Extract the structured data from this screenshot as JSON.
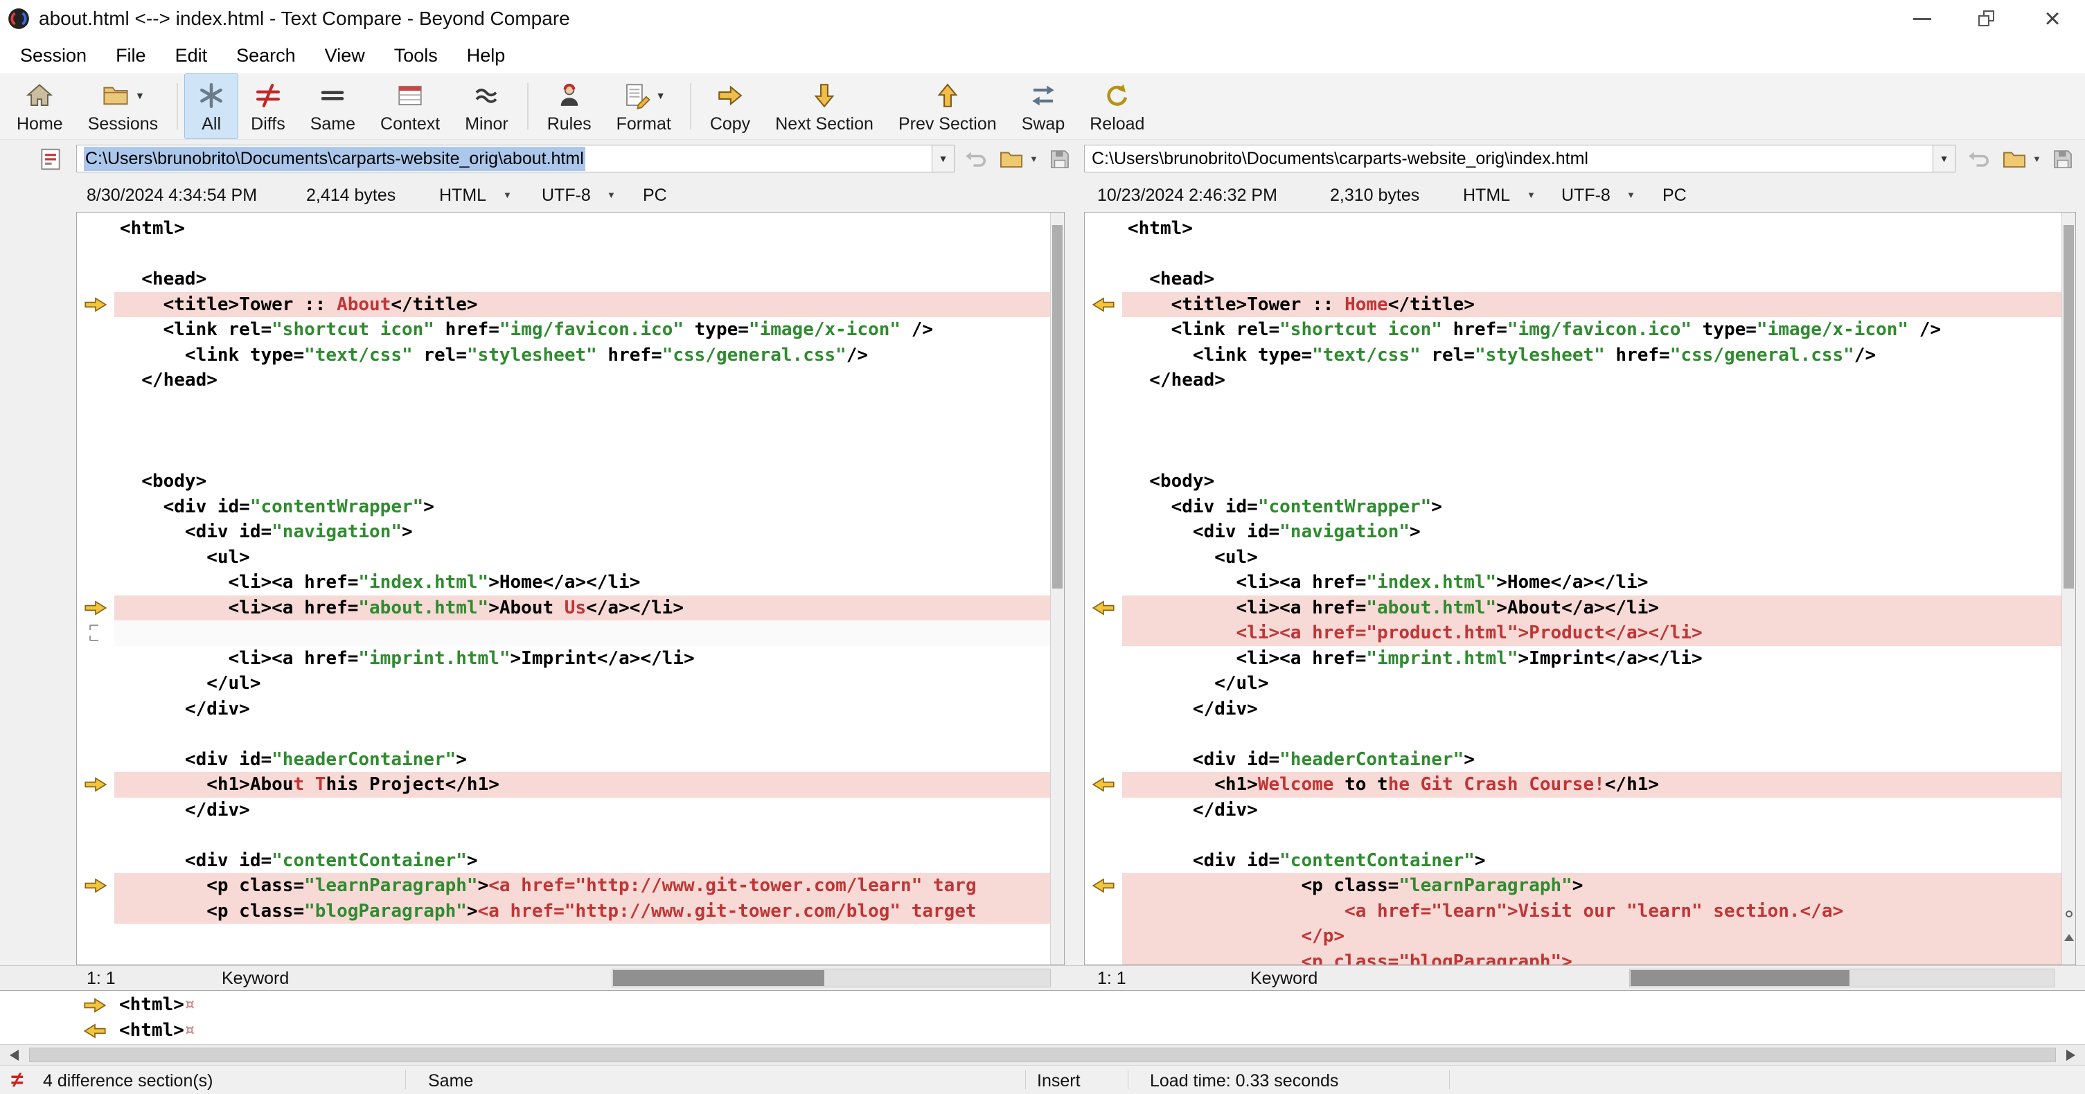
{
  "window": {
    "title": "about.html <--> index.html - Text Compare - Beyond Compare"
  },
  "menu": {
    "items": [
      "Session",
      "File",
      "Edit",
      "Search",
      "View",
      "Tools",
      "Help"
    ]
  },
  "toolbar": {
    "items": [
      {
        "label": "Home",
        "icon": "home-icon"
      },
      {
        "label": "Sessions",
        "icon": "sessions-icon",
        "has_dropdown": true
      },
      {
        "label": "All",
        "icon": "asterisk-icon",
        "active": true
      },
      {
        "label": "Diffs",
        "icon": "not-equal-icon"
      },
      {
        "label": "Same",
        "icon": "equals-icon"
      },
      {
        "label": "Context",
        "icon": "context-icon"
      },
      {
        "label": "Minor",
        "icon": "tilde-icon"
      },
      {
        "label": "Rules",
        "icon": "rules-icon"
      },
      {
        "label": "Format",
        "icon": "format-icon",
        "has_dropdown": true
      },
      {
        "label": "Copy",
        "icon": "copy-arrow-icon"
      },
      {
        "label": "Next Section",
        "icon": "arrow-down-icon"
      },
      {
        "label": "Prev Section",
        "icon": "arrow-up-icon"
      },
      {
        "label": "Swap",
        "icon": "swap-icon"
      },
      {
        "label": "Reload",
        "icon": "reload-icon"
      }
    ]
  },
  "left_file": {
    "path": "C:\\Users\\brunobrito\\Documents\\carparts-website_orig\\about.html",
    "modified": "8/30/2024 4:34:54 PM",
    "size": "2,414 bytes",
    "format": "HTML",
    "encoding": "UTF-8",
    "line_ending": "PC",
    "cursor": "1: 1",
    "grammar": "Keyword"
  },
  "right_file": {
    "path": "C:\\Users\\brunobrito\\Documents\\carparts-website_orig\\index.html",
    "modified": "10/23/2024 2:46:32 PM",
    "size": "2,310 bytes",
    "format": "HTML",
    "encoding": "UTF-8",
    "line_ending": "PC",
    "cursor": "1: 1",
    "grammar": "Keyword"
  },
  "left_lines": [
    {
      "spans": [
        [
          "t",
          "<html>"
        ]
      ]
    },
    {
      "spans": []
    },
    {
      "spans": [
        [
          "t",
          "  <head>"
        ]
      ]
    },
    {
      "bg": "d",
      "mk": "a",
      "spans": [
        [
          "t",
          "    <title>"
        ],
        [
          "n",
          "Tower :: "
        ],
        [
          "d",
          "About"
        ],
        [
          "t",
          "</title>"
        ]
      ]
    },
    {
      "spans": [
        [
          "t",
          "    <link rel="
        ],
        [
          "s",
          "\"shortcut icon\""
        ],
        [
          "t",
          " href="
        ],
        [
          "s",
          "\"img/favicon.ico\""
        ],
        [
          "t",
          " type="
        ],
        [
          "s",
          "\"image/x-icon\""
        ],
        [
          "t",
          " />"
        ]
      ]
    },
    {
      "spans": [
        [
          "t",
          "      <link type="
        ],
        [
          "s",
          "\"text/css\""
        ],
        [
          "t",
          " rel="
        ],
        [
          "s",
          "\"stylesheet\""
        ],
        [
          "t",
          " href="
        ],
        [
          "s",
          "\"css/general.css\""
        ],
        [
          "t",
          "/>"
        ]
      ]
    },
    {
      "spans": [
        [
          "t",
          "  </head>"
        ]
      ]
    },
    {
      "spans": []
    },
    {
      "spans": []
    },
    {
      "spans": []
    },
    {
      "spans": [
        [
          "t",
          "  <body>"
        ]
      ]
    },
    {
      "spans": [
        [
          "t",
          "    <div id="
        ],
        [
          "s",
          "\"contentWrapper\""
        ],
        [
          "t",
          ">"
        ]
      ]
    },
    {
      "spans": [
        [
          "t",
          "      <div id="
        ],
        [
          "s",
          "\"navigation\""
        ],
        [
          "t",
          ">"
        ]
      ]
    },
    {
      "spans": [
        [
          "t",
          "        <ul>"
        ]
      ]
    },
    {
      "spans": [
        [
          "t",
          "          <li><a href="
        ],
        [
          "s",
          "\"index.html\""
        ],
        [
          "t",
          ">Home</a></li>"
        ]
      ]
    },
    {
      "bg": "d",
      "mk": "a",
      "spans": [
        [
          "t",
          "          <li><a href="
        ],
        [
          "s",
          "\"about.html\""
        ],
        [
          "t",
          ">About"
        ],
        [
          "d",
          " Us"
        ],
        [
          "t",
          "</a></li>"
        ]
      ]
    },
    {
      "bg": "g",
      "mk": "gb",
      "spans": []
    },
    {
      "spans": [
        [
          "t",
          "          <li><a href="
        ],
        [
          "s",
          "\"imprint.html\""
        ],
        [
          "t",
          ">Imprint</a></li>"
        ]
      ]
    },
    {
      "spans": [
        [
          "t",
          "        </ul>"
        ]
      ]
    },
    {
      "spans": [
        [
          "t",
          "      </div>"
        ]
      ]
    },
    {
      "spans": []
    },
    {
      "spans": [
        [
          "t",
          "      <div id="
        ],
        [
          "s",
          "\"headerContainer\""
        ],
        [
          "t",
          ">"
        ]
      ]
    },
    {
      "bg": "d",
      "mk": "a",
      "spans": [
        [
          "t",
          "        <h1>"
        ],
        [
          "n",
          "Abou"
        ],
        [
          "d",
          "t T"
        ],
        [
          "n",
          "his Project"
        ],
        [
          "t",
          "</h1>"
        ]
      ]
    },
    {
      "spans": [
        [
          "t",
          "      </div>"
        ]
      ]
    },
    {
      "spans": []
    },
    {
      "spans": [
        [
          "t",
          "      <div id="
        ],
        [
          "s",
          "\"contentContainer\""
        ],
        [
          "t",
          ">"
        ]
      ]
    },
    {
      "bg": "d",
      "mk": "a",
      "spans": [
        [
          "t",
          "        <p class="
        ],
        [
          "s",
          "\"learnParagraph\""
        ],
        [
          "t",
          ">"
        ],
        [
          "d",
          "<a href=\"http://www.git-tower.com/learn\" targ"
        ]
      ]
    },
    {
      "bg": "d",
      "spans": [
        [
          "t",
          "        <p class="
        ],
        [
          "s",
          "\"blogParagraph\""
        ],
        [
          "t",
          ">"
        ],
        [
          "d",
          "<a href=\"http://www.git-tower.com/blog\" target"
        ]
      ]
    }
  ],
  "right_lines": [
    {
      "spans": [
        [
          "t",
          "<html>"
        ]
      ]
    },
    {
      "spans": []
    },
    {
      "spans": [
        [
          "t",
          "  <head>"
        ]
      ]
    },
    {
      "bg": "d",
      "mk": "a",
      "spans": [
        [
          "t",
          "    <title>"
        ],
        [
          "n",
          "Tower :: "
        ],
        [
          "d",
          "Home"
        ],
        [
          "t",
          "</title>"
        ]
      ]
    },
    {
      "spans": [
        [
          "t",
          "    <link rel="
        ],
        [
          "s",
          "\"shortcut icon\""
        ],
        [
          "t",
          " href="
        ],
        [
          "s",
          "\"img/favicon.ico\""
        ],
        [
          "t",
          " type="
        ],
        [
          "s",
          "\"image/x-icon\""
        ],
        [
          "t",
          " />"
        ]
      ]
    },
    {
      "spans": [
        [
          "t",
          "      <link type="
        ],
        [
          "s",
          "\"text/css\""
        ],
        [
          "t",
          " rel="
        ],
        [
          "s",
          "\"stylesheet\""
        ],
        [
          "t",
          " href="
        ],
        [
          "s",
          "\"css/general.css\""
        ],
        [
          "t",
          "/>"
        ]
      ]
    },
    {
      "spans": [
        [
          "t",
          "  </head>"
        ]
      ]
    },
    {
      "spans": []
    },
    {
      "spans": []
    },
    {
      "spans": []
    },
    {
      "spans": [
        [
          "t",
          "  <body>"
        ]
      ]
    },
    {
      "spans": [
        [
          "t",
          "    <div id="
        ],
        [
          "s",
          "\"contentWrapper\""
        ],
        [
          "t",
          ">"
        ]
      ]
    },
    {
      "spans": [
        [
          "t",
          "      <div id="
        ],
        [
          "s",
          "\"navigation\""
        ],
        [
          "t",
          ">"
        ]
      ]
    },
    {
      "spans": [
        [
          "t",
          "        <ul>"
        ]
      ]
    },
    {
      "spans": [
        [
          "t",
          "          <li><a href="
        ],
        [
          "s",
          "\"index.html\""
        ],
        [
          "t",
          ">Home</a></li>"
        ]
      ]
    },
    {
      "bg": "d",
      "mk": "a",
      "spans": [
        [
          "t",
          "          <li><a href="
        ],
        [
          "s",
          "\"about.html\""
        ],
        [
          "t",
          ">About</a></li>"
        ]
      ]
    },
    {
      "bg": "d",
      "spans": [
        [
          "d",
          "          <li><a href=\"product.html\">Product</a></li>"
        ]
      ]
    },
    {
      "spans": [
        [
          "t",
          "          <li><a href="
        ],
        [
          "s",
          "\"imprint.html\""
        ],
        [
          "t",
          ">Imprint</a></li>"
        ]
      ]
    },
    {
      "spans": [
        [
          "t",
          "        </ul>"
        ]
      ]
    },
    {
      "spans": [
        [
          "t",
          "      </div>"
        ]
      ]
    },
    {
      "spans": []
    },
    {
      "spans": [
        [
          "t",
          "      <div id="
        ],
        [
          "s",
          "\"headerContainer\""
        ],
        [
          "t",
          ">"
        ]
      ]
    },
    {
      "bg": "d",
      "mk": "a",
      "spans": [
        [
          "t",
          "        <h1>"
        ],
        [
          "d",
          "Welcome "
        ],
        [
          "n",
          "to t"
        ],
        [
          "d",
          "he Git Crash Course!"
        ],
        [
          "t",
          "</h1>"
        ]
      ]
    },
    {
      "spans": [
        [
          "t",
          "      </div>"
        ]
      ]
    },
    {
      "spans": []
    },
    {
      "spans": [
        [
          "t",
          "      <div id="
        ],
        [
          "s",
          "\"contentContainer\""
        ],
        [
          "t",
          ">"
        ]
      ]
    },
    {
      "bg": "d",
      "mk": "a",
      "spans": [
        [
          "t",
          "                <p class="
        ],
        [
          "s",
          "\"learnParagraph\""
        ],
        [
          "t",
          ">"
        ]
      ]
    },
    {
      "bg": "d",
      "spans": [
        [
          "d",
          "                    <a href=\"learn\">Visit our \"learn\" section.</a>"
        ]
      ]
    },
    {
      "bg": "d",
      "spans": [
        [
          "d",
          "                </p>"
        ]
      ]
    },
    {
      "bg": "d",
      "spans": [
        [
          "d",
          "                <p class=\"blogParagraph\">"
        ]
      ]
    }
  ],
  "detail": {
    "rows": [
      {
        "dir": "right",
        "spans": [
          [
            "t",
            "<html>"
          ],
          [
            "g",
            "¤"
          ]
        ]
      },
      {
        "dir": "left",
        "spans": [
          [
            "t",
            "<html>"
          ],
          [
            "g",
            "¤"
          ]
        ]
      }
    ]
  },
  "status": {
    "differences": "4 difference section(s)",
    "compare_state": "Same",
    "input_mode": "Insert",
    "load_time": "Load time: 0.33 seconds"
  },
  "colors": {
    "diff_row_background": "#f7d9d6",
    "diff_text": "#c03535",
    "string_text": "#2f8b2f",
    "selection_background": "#abc8ec",
    "marker_arrow": "#f2c53d"
  }
}
